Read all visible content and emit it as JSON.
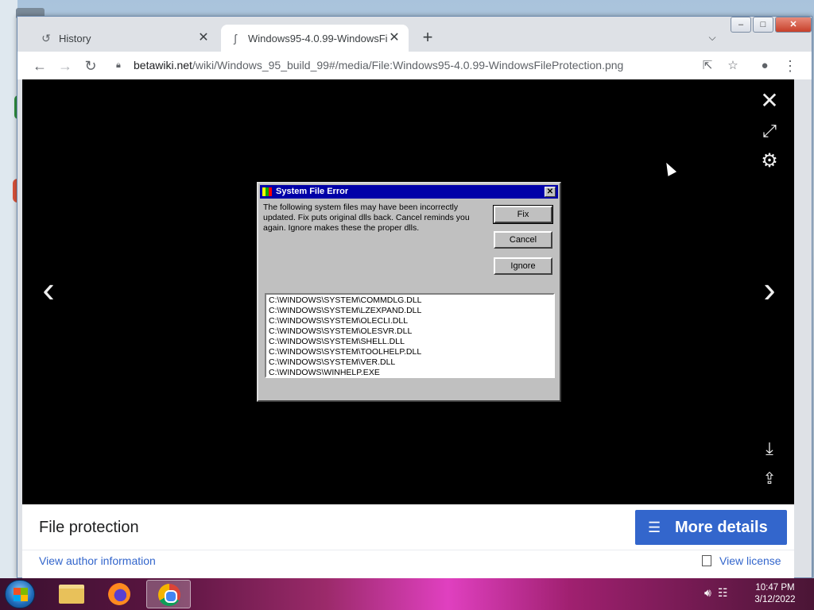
{
  "browser": {
    "tabs": [
      {
        "label": "History",
        "icon": "history-icon"
      },
      {
        "label": "Windows95-4.0.99-WindowsFileP",
        "icon": "wiki-icon"
      }
    ],
    "new_tab": "+",
    "url_host": "betawiki.net",
    "url_path": "/wiki/Windows_95_build_99#/media/File:Windows95-4.0.99-WindowsFileProtection.png"
  },
  "dialog": {
    "title": "System File Error",
    "message": "The following system files may have been incorrectly updated. Fix puts original dlls back. Cancel reminds you again.  Ignore makes these the proper dlls.",
    "buttons": {
      "fix": "Fix",
      "cancel": "Cancel",
      "ignore": "Ignore"
    },
    "files": [
      "C:\\WINDOWS\\SYSTEM\\COMMDLG.DLL",
      "C:\\WINDOWS\\SYSTEM\\LZEXPAND.DLL",
      "C:\\WINDOWS\\SYSTEM\\OLECLI.DLL",
      "C:\\WINDOWS\\SYSTEM\\OLESVR.DLL",
      "C:\\WINDOWS\\SYSTEM\\SHELL.DLL",
      "C:\\WINDOWS\\SYSTEM\\TOOLHELP.DLL",
      "C:\\WINDOWS\\SYSTEM\\VER.DLL",
      "C:\\WINDOWS\\WINHELP.EXE"
    ]
  },
  "caption": {
    "title": "File protection",
    "more_details": "More details",
    "author_link": "View author information",
    "license_link": "View license"
  },
  "taskbar": {
    "time": "10:47 PM",
    "date": "3/12/2022"
  },
  "colors": {
    "more_button": "#3366cc",
    "dialog_title_bar": "#0000a8",
    "link": "#3366cc"
  }
}
